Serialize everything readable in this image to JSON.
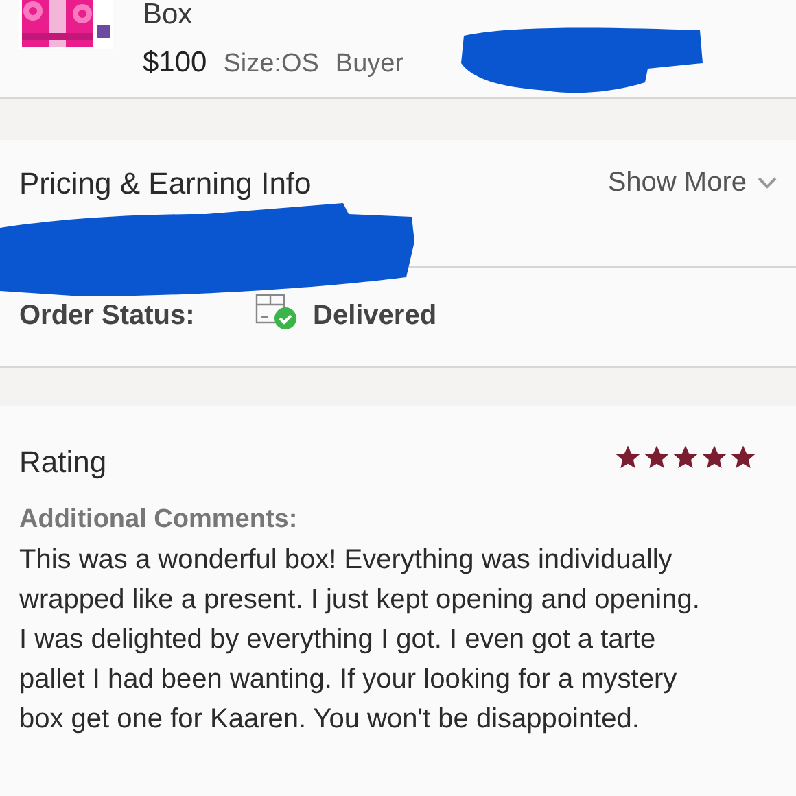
{
  "item": {
    "title": "Box",
    "price": "$100",
    "size": "Size:OS",
    "buyer": "Buyer"
  },
  "pricing": {
    "title": "Pricing & Earning Info",
    "show_more": "Show More"
  },
  "order_status": {
    "label": "Order Status:",
    "value": "Delivered",
    "delivered": true
  },
  "rating": {
    "title": "Rating",
    "stars": 5,
    "comments_label": "Additional Comments:",
    "comments": "This was a wonderful box! Everything was individually wrapped like a present. I just kept opening and opening. I was delighted by everything I got. I even got a tarte pallet I had been wanting. If your looking for a mystery box get one for Kaaren. You won't be disappointed."
  }
}
